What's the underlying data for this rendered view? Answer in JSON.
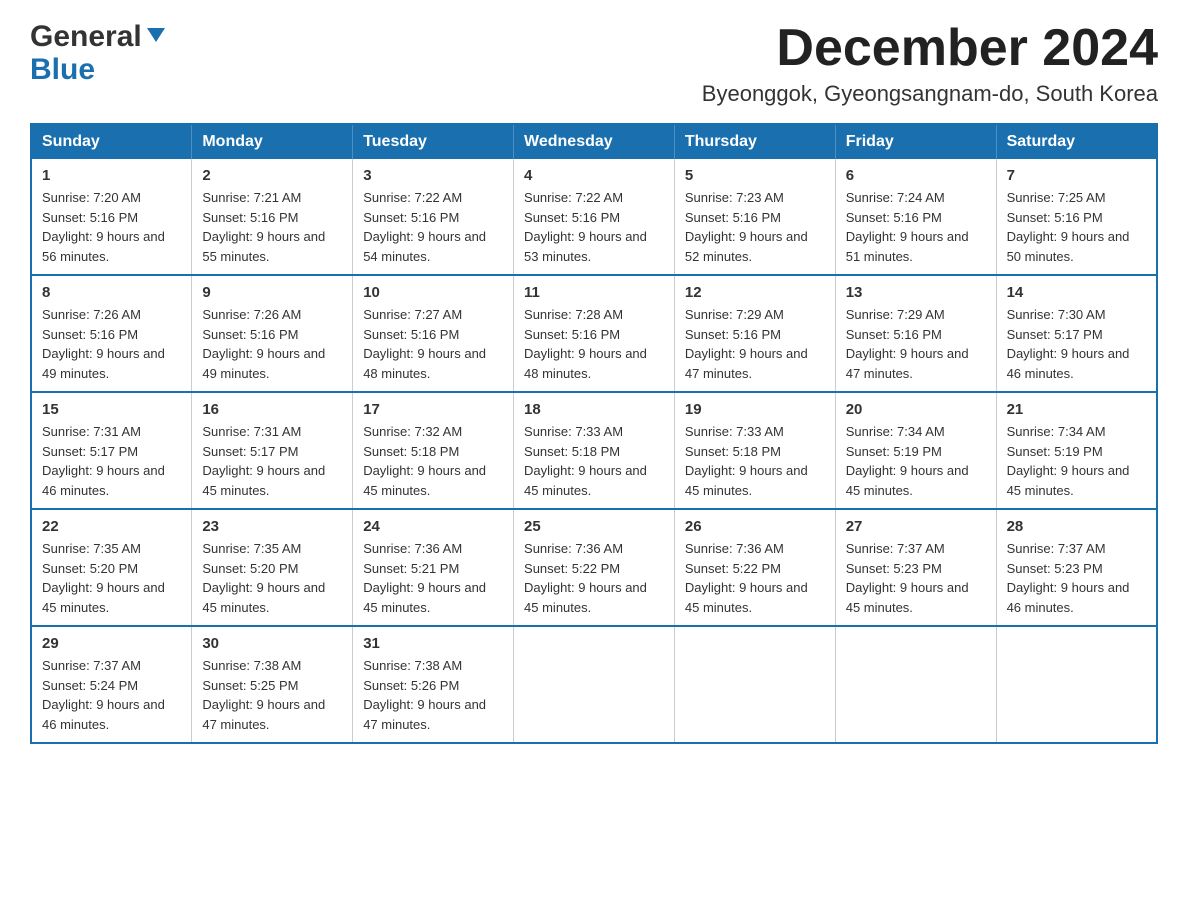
{
  "header": {
    "logo_general": "General",
    "logo_blue": "Blue",
    "month_title": "December 2024",
    "location": "Byeonggok, Gyeongsangnam-do, South Korea"
  },
  "weekdays": [
    "Sunday",
    "Monday",
    "Tuesday",
    "Wednesday",
    "Thursday",
    "Friday",
    "Saturday"
  ],
  "weeks": [
    [
      {
        "day": "1",
        "sunrise": "Sunrise: 7:20 AM",
        "sunset": "Sunset: 5:16 PM",
        "daylight": "Daylight: 9 hours and 56 minutes."
      },
      {
        "day": "2",
        "sunrise": "Sunrise: 7:21 AM",
        "sunset": "Sunset: 5:16 PM",
        "daylight": "Daylight: 9 hours and 55 minutes."
      },
      {
        "day": "3",
        "sunrise": "Sunrise: 7:22 AM",
        "sunset": "Sunset: 5:16 PM",
        "daylight": "Daylight: 9 hours and 54 minutes."
      },
      {
        "day": "4",
        "sunrise": "Sunrise: 7:22 AM",
        "sunset": "Sunset: 5:16 PM",
        "daylight": "Daylight: 9 hours and 53 minutes."
      },
      {
        "day": "5",
        "sunrise": "Sunrise: 7:23 AM",
        "sunset": "Sunset: 5:16 PM",
        "daylight": "Daylight: 9 hours and 52 minutes."
      },
      {
        "day": "6",
        "sunrise": "Sunrise: 7:24 AM",
        "sunset": "Sunset: 5:16 PM",
        "daylight": "Daylight: 9 hours and 51 minutes."
      },
      {
        "day": "7",
        "sunrise": "Sunrise: 7:25 AM",
        "sunset": "Sunset: 5:16 PM",
        "daylight": "Daylight: 9 hours and 50 minutes."
      }
    ],
    [
      {
        "day": "8",
        "sunrise": "Sunrise: 7:26 AM",
        "sunset": "Sunset: 5:16 PM",
        "daylight": "Daylight: 9 hours and 49 minutes."
      },
      {
        "day": "9",
        "sunrise": "Sunrise: 7:26 AM",
        "sunset": "Sunset: 5:16 PM",
        "daylight": "Daylight: 9 hours and 49 minutes."
      },
      {
        "day": "10",
        "sunrise": "Sunrise: 7:27 AM",
        "sunset": "Sunset: 5:16 PM",
        "daylight": "Daylight: 9 hours and 48 minutes."
      },
      {
        "day": "11",
        "sunrise": "Sunrise: 7:28 AM",
        "sunset": "Sunset: 5:16 PM",
        "daylight": "Daylight: 9 hours and 48 minutes."
      },
      {
        "day": "12",
        "sunrise": "Sunrise: 7:29 AM",
        "sunset": "Sunset: 5:16 PM",
        "daylight": "Daylight: 9 hours and 47 minutes."
      },
      {
        "day": "13",
        "sunrise": "Sunrise: 7:29 AM",
        "sunset": "Sunset: 5:16 PM",
        "daylight": "Daylight: 9 hours and 47 minutes."
      },
      {
        "day": "14",
        "sunrise": "Sunrise: 7:30 AM",
        "sunset": "Sunset: 5:17 PM",
        "daylight": "Daylight: 9 hours and 46 minutes."
      }
    ],
    [
      {
        "day": "15",
        "sunrise": "Sunrise: 7:31 AM",
        "sunset": "Sunset: 5:17 PM",
        "daylight": "Daylight: 9 hours and 46 minutes."
      },
      {
        "day": "16",
        "sunrise": "Sunrise: 7:31 AM",
        "sunset": "Sunset: 5:17 PM",
        "daylight": "Daylight: 9 hours and 45 minutes."
      },
      {
        "day": "17",
        "sunrise": "Sunrise: 7:32 AM",
        "sunset": "Sunset: 5:18 PM",
        "daylight": "Daylight: 9 hours and 45 minutes."
      },
      {
        "day": "18",
        "sunrise": "Sunrise: 7:33 AM",
        "sunset": "Sunset: 5:18 PM",
        "daylight": "Daylight: 9 hours and 45 minutes."
      },
      {
        "day": "19",
        "sunrise": "Sunrise: 7:33 AM",
        "sunset": "Sunset: 5:18 PM",
        "daylight": "Daylight: 9 hours and 45 minutes."
      },
      {
        "day": "20",
        "sunrise": "Sunrise: 7:34 AM",
        "sunset": "Sunset: 5:19 PM",
        "daylight": "Daylight: 9 hours and 45 minutes."
      },
      {
        "day": "21",
        "sunrise": "Sunrise: 7:34 AM",
        "sunset": "Sunset: 5:19 PM",
        "daylight": "Daylight: 9 hours and 45 minutes."
      }
    ],
    [
      {
        "day": "22",
        "sunrise": "Sunrise: 7:35 AM",
        "sunset": "Sunset: 5:20 PM",
        "daylight": "Daylight: 9 hours and 45 minutes."
      },
      {
        "day": "23",
        "sunrise": "Sunrise: 7:35 AM",
        "sunset": "Sunset: 5:20 PM",
        "daylight": "Daylight: 9 hours and 45 minutes."
      },
      {
        "day": "24",
        "sunrise": "Sunrise: 7:36 AM",
        "sunset": "Sunset: 5:21 PM",
        "daylight": "Daylight: 9 hours and 45 minutes."
      },
      {
        "day": "25",
        "sunrise": "Sunrise: 7:36 AM",
        "sunset": "Sunset: 5:22 PM",
        "daylight": "Daylight: 9 hours and 45 minutes."
      },
      {
        "day": "26",
        "sunrise": "Sunrise: 7:36 AM",
        "sunset": "Sunset: 5:22 PM",
        "daylight": "Daylight: 9 hours and 45 minutes."
      },
      {
        "day": "27",
        "sunrise": "Sunrise: 7:37 AM",
        "sunset": "Sunset: 5:23 PM",
        "daylight": "Daylight: 9 hours and 45 minutes."
      },
      {
        "day": "28",
        "sunrise": "Sunrise: 7:37 AM",
        "sunset": "Sunset: 5:23 PM",
        "daylight": "Daylight: 9 hours and 46 minutes."
      }
    ],
    [
      {
        "day": "29",
        "sunrise": "Sunrise: 7:37 AM",
        "sunset": "Sunset: 5:24 PM",
        "daylight": "Daylight: 9 hours and 46 minutes."
      },
      {
        "day": "30",
        "sunrise": "Sunrise: 7:38 AM",
        "sunset": "Sunset: 5:25 PM",
        "daylight": "Daylight: 9 hours and 47 minutes."
      },
      {
        "day": "31",
        "sunrise": "Sunrise: 7:38 AM",
        "sunset": "Sunset: 5:26 PM",
        "daylight": "Daylight: 9 hours and 47 minutes."
      },
      null,
      null,
      null,
      null
    ]
  ]
}
